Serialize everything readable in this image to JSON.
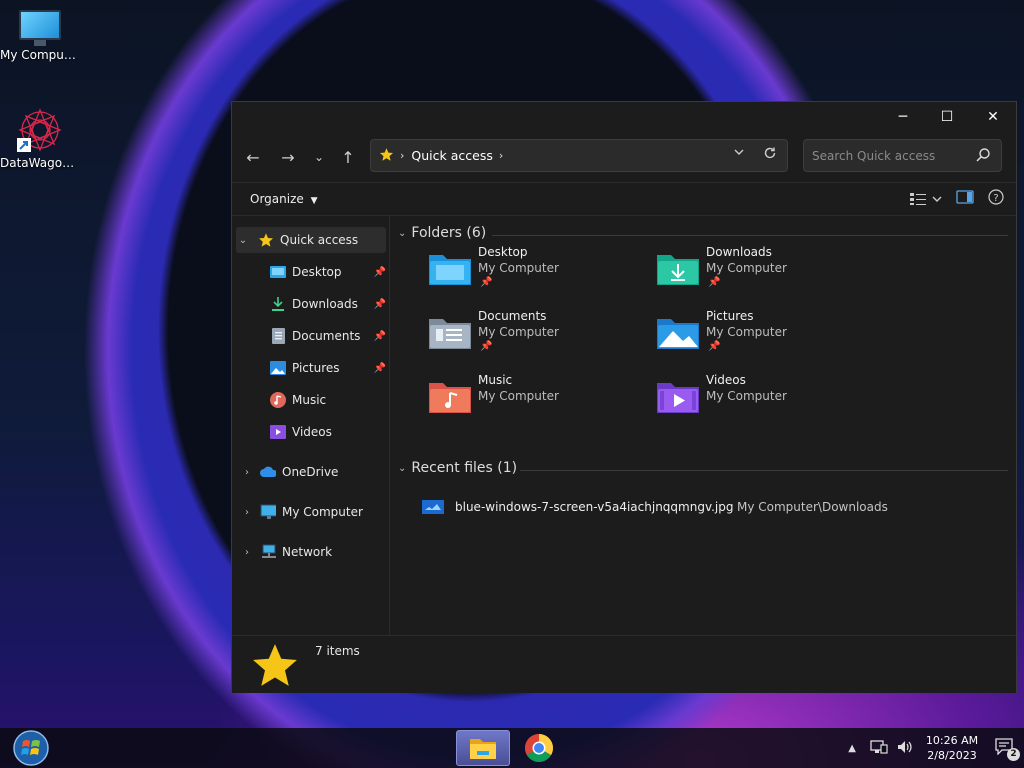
{
  "desktop": {
    "icons": [
      {
        "label": "My Computer",
        "icon": "monitor-icon"
      },
      {
        "label": "DataWagon...",
        "icon": "mandala-shortcut-icon"
      }
    ]
  },
  "window": {
    "controls": {
      "minimize": "─",
      "maximize": "☐",
      "close": "✕"
    },
    "nav": {
      "back": "←",
      "forward": "→",
      "recent": "⌄",
      "up": "↑"
    },
    "address": {
      "path": [
        "Quick access"
      ],
      "separator": "›"
    },
    "search": {
      "placeholder": "Search Quick access"
    },
    "cmdbar": {
      "organize": "Organize"
    },
    "sidebar": {
      "quick_access": "Quick access",
      "pinned": [
        {
          "label": "Desktop",
          "icon": "desktop-folder-icon",
          "pinned": true
        },
        {
          "label": "Downloads",
          "icon": "download-icon",
          "pinned": true
        },
        {
          "label": "Documents",
          "icon": "document-icon",
          "pinned": true
        },
        {
          "label": "Pictures",
          "icon": "pictures-icon",
          "pinned": true
        },
        {
          "label": "Music",
          "icon": "music-icon",
          "pinned": false
        },
        {
          "label": "Videos",
          "icon": "videos-icon",
          "pinned": false
        }
      ],
      "roots": [
        {
          "label": "OneDrive",
          "icon": "cloud-icon"
        },
        {
          "label": "My Computer",
          "icon": "monitor-icon"
        },
        {
          "label": "Network",
          "icon": "network-icon"
        }
      ]
    },
    "folders_header": "Folders (6)",
    "folders": [
      {
        "name": "Desktop",
        "location": "My Computer",
        "pinned": true,
        "icon": "desktop-folder-icon"
      },
      {
        "name": "Downloads",
        "location": "My Computer",
        "pinned": true,
        "icon": "downloads-folder-icon"
      },
      {
        "name": "Documents",
        "location": "My Computer",
        "pinned": true,
        "icon": "documents-folder-icon"
      },
      {
        "name": "Pictures",
        "location": "My Computer",
        "pinned": true,
        "icon": "pictures-folder-icon"
      },
      {
        "name": "Music",
        "location": "My Computer",
        "pinned": false,
        "icon": "music-folder-icon"
      },
      {
        "name": "Videos",
        "location": "My Computer",
        "pinned": false,
        "icon": "videos-folder-icon"
      }
    ],
    "recent_header": "Recent files (1)",
    "recent_files": [
      {
        "name": "blue-windows-7-screen-v5a4iachjnqqmngv.jpg",
        "location": "My Computer\\Downloads"
      }
    ],
    "status": {
      "items": "7 items"
    }
  },
  "taskbar": {
    "clock": {
      "time": "10:26 AM",
      "date": "2/8/2023"
    },
    "notification_count": "2"
  },
  "colors": {
    "accent": "#f5c518",
    "window_bg": "#1c1c1c",
    "folder_blue": "#2aa7e8"
  }
}
